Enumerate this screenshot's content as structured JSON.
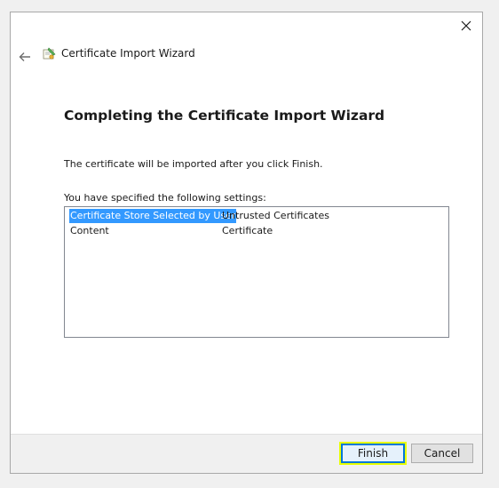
{
  "window": {
    "title": "Certificate Import Wizard"
  },
  "main": {
    "heading": "Completing the Certificate Import Wizard",
    "info": "The certificate will be imported after you click Finish.",
    "settings_label": "You have specified the following settings:",
    "settings": [
      {
        "key": "Certificate Store Selected by User",
        "value": "Untrusted Certificates",
        "selected": true
      },
      {
        "key": "Content",
        "value": "Certificate",
        "selected": false
      }
    ]
  },
  "footer": {
    "finish_label": "Finish",
    "cancel_label": "Cancel"
  },
  "colors": {
    "selection": "#3399ff",
    "finish_highlight": "#e8ff00",
    "finish_border": "#0078d7"
  },
  "icons": {
    "close": "close-icon",
    "back": "back-arrow-icon",
    "title": "certificate-icon"
  }
}
